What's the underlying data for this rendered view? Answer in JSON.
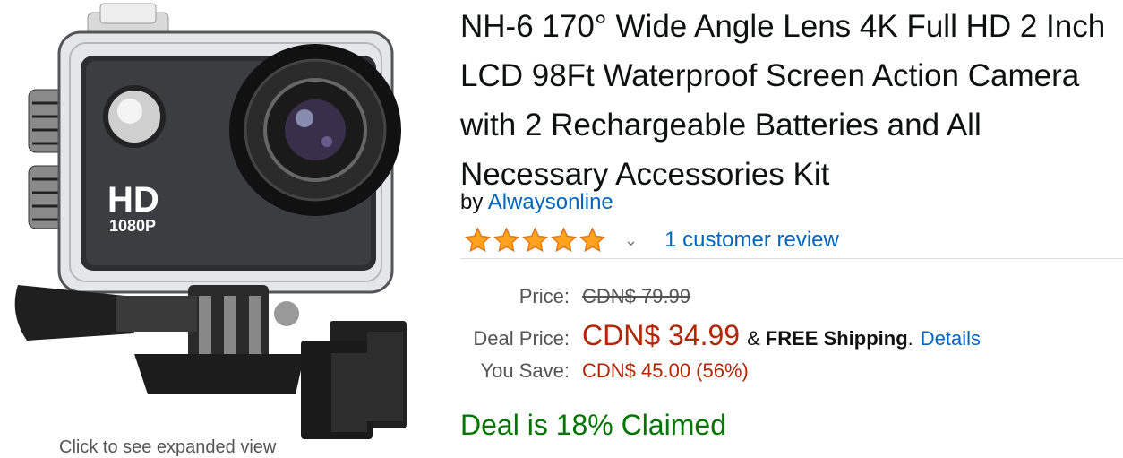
{
  "product": {
    "title": "NH-6 170° Wide Angle Lens 4K Full HD 2 Inch LCD 98Ft Waterproof Screen Action Camera with 2 Rechargeable Batteries and All Necessary Accessories Kit",
    "by_prefix": "by",
    "brand": "Alwaysonline",
    "rating_stars": 5,
    "review_count_text": "1 customer review",
    "image": {
      "camera_badge": "HD",
      "camera_resolution": "1080P",
      "caption": "Click to see expanded view"
    }
  },
  "pricing": {
    "price_label": "Price:",
    "list_price": "CDN$ 79.99",
    "deal_label": "Deal Price:",
    "deal_price": "CDN$ 34.99",
    "amp": "&",
    "free_shipping": "FREE Shipping",
    "period": ".",
    "details_link": "Details",
    "save_label": "You Save:",
    "save_amount": "CDN$ 45.00 (56%)"
  },
  "deal": {
    "claimed_text": "Deal is 18% Claimed"
  },
  "colors": {
    "link": "#0066c0",
    "price": "#b12704",
    "deal_green": "#007600",
    "star": "#ffa41c"
  },
  "icons": {
    "star": "star-icon",
    "chevron": "chevron-down-icon"
  }
}
